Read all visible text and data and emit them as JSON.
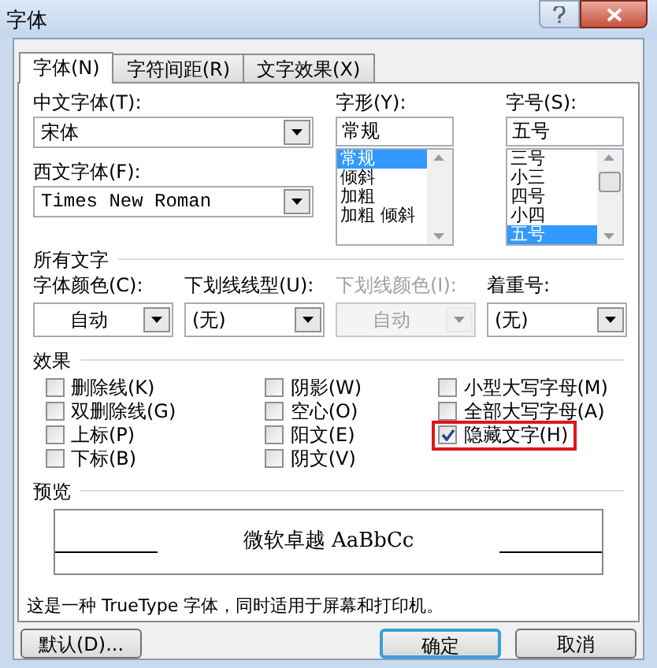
{
  "window": {
    "title": "字体"
  },
  "tabs": [
    {
      "label": "字体(N)",
      "selected": true
    },
    {
      "label": "字符间距(R)",
      "selected": false
    },
    {
      "label": "文字效果(X)",
      "selected": false
    }
  ],
  "font": {
    "chinese_label": "中文字体(T):",
    "chinese_value": "宋体",
    "western_label": "西文字体(F):",
    "western_value": "Times New Roman"
  },
  "style": {
    "label": "字形(Y):",
    "value": "常规",
    "items": [
      {
        "label": "常规",
        "selected": true
      },
      {
        "label": "倾斜",
        "selected": false
      },
      {
        "label": "加粗",
        "selected": false
      },
      {
        "label": "加粗 倾斜",
        "selected": false
      }
    ]
  },
  "size": {
    "label": "字号(S):",
    "value": "五号",
    "items": [
      {
        "label": "三号",
        "selected": false
      },
      {
        "label": "小三",
        "selected": false
      },
      {
        "label": "四号",
        "selected": false
      },
      {
        "label": "小四",
        "selected": false
      },
      {
        "label": "五号",
        "selected": true
      }
    ]
  },
  "all_text": {
    "title": "所有文字",
    "fields": [
      {
        "label": "字体颜色(C):",
        "value": "自动",
        "kind": "color",
        "disabled": false
      },
      {
        "label": "下划线线型(U):",
        "value": "(无)",
        "kind": "list",
        "disabled": false
      },
      {
        "label": "下划线颜色(I):",
        "value": "自动",
        "kind": "color",
        "disabled": true
      },
      {
        "label": "着重号:",
        "value": "(无)",
        "kind": "list",
        "disabled": false
      }
    ]
  },
  "effects": {
    "title": "效果",
    "columns": [
      [
        {
          "label": "删除线(K)",
          "checked": false,
          "highlighted": false
        },
        {
          "label": "双删除线(G)",
          "checked": false,
          "highlighted": false
        },
        {
          "label": "上标(P)",
          "checked": false,
          "highlighted": false
        },
        {
          "label": "下标(B)",
          "checked": false,
          "highlighted": false
        }
      ],
      [
        {
          "label": "阴影(W)",
          "checked": false,
          "highlighted": false
        },
        {
          "label": "空心(O)",
          "checked": false,
          "highlighted": false
        },
        {
          "label": "阳文(E)",
          "checked": false,
          "highlighted": false
        },
        {
          "label": "阴文(V)",
          "checked": false,
          "highlighted": false
        }
      ],
      [
        {
          "label": "小型大写字母(M)",
          "checked": false,
          "highlighted": false
        },
        {
          "label": "全部大写字母(A)",
          "checked": false,
          "highlighted": false
        },
        {
          "label": "隐藏文字(H)",
          "checked": true,
          "highlighted": true
        }
      ]
    ]
  },
  "preview": {
    "title": "预览",
    "sample": "微软卓越 AaBbCc",
    "note": "这是一种 TrueType 字体，同时适用于屏幕和打印机。"
  },
  "buttons": [
    {
      "label": "默认(D)...",
      "default": false
    },
    {
      "label": "确定",
      "default": true
    },
    {
      "label": "取消",
      "default": false
    }
  ]
}
